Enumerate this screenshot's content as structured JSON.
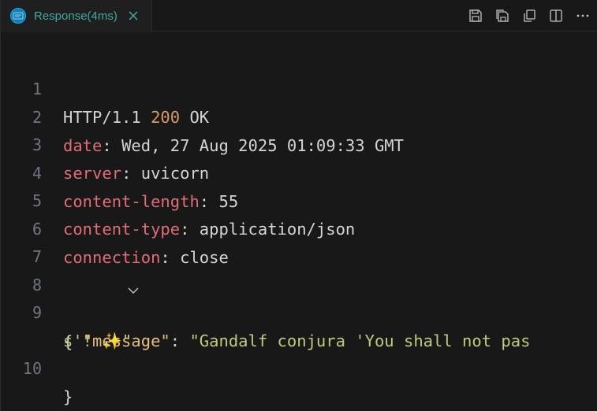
{
  "tab": {
    "title": "Response(4ms)",
    "icon": "rest-client-icon",
    "close_icon": "close-icon"
  },
  "toolbar": {
    "actions": [
      "save-icon",
      "save-all-icon",
      "copy-icon",
      "split-editor-icon",
      "more-icon"
    ]
  },
  "colors": {
    "header_key": "#e06c75",
    "status_code": "#d19a66",
    "json_key": "#e5c07b",
    "json_string": "#c3c97a",
    "tab_label": "#3fa9a0"
  },
  "response": {
    "line_numbers": [
      "1",
      "2",
      "3",
      "4",
      "5",
      "6",
      "7",
      "8",
      "9",
      "10"
    ],
    "status_line": {
      "protocol": "HTTP/1.1 ",
      "code": "200",
      "text": " OK"
    },
    "headers": [
      {
        "key": "date",
        "sep": ": ",
        "value": "Wed, 27 Aug 2025 01:09:33 GMT"
      },
      {
        "key": "server",
        "sep": ": ",
        "value": "uvicorn"
      },
      {
        "key": "content-length",
        "sep": ": ",
        "value": "55"
      },
      {
        "key": "content-type",
        "sep": ": ",
        "value": "application/json"
      },
      {
        "key": "connection",
        "sep": ": ",
        "value": "close"
      }
    ],
    "body": {
      "open_brace": "{",
      "indent": "  ",
      "key": "\"message\"",
      "colon": ": ",
      "value_part1": "\"Gandalf conjura 'You shall not pas",
      "value_part2": "s'! ✨\"",
      "close_brace": "}"
    }
  }
}
